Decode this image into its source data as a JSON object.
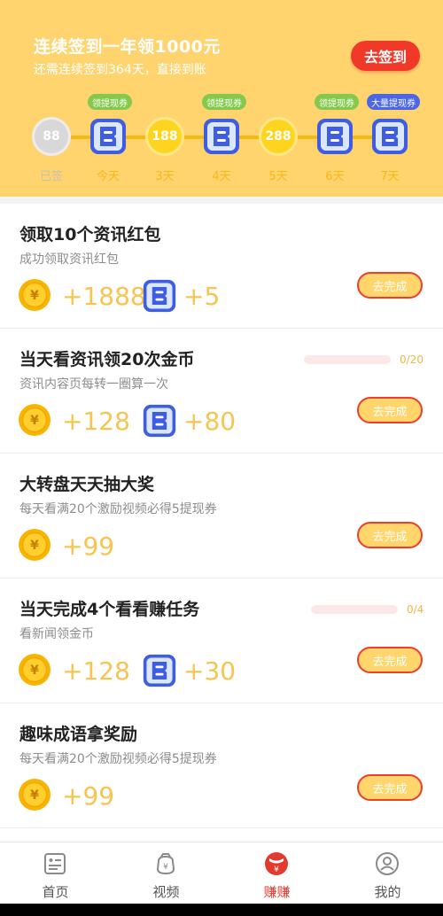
{
  "banner": {
    "title": "连续签到一年领1000元",
    "subtitle": "还需连续签到364天，直接到账",
    "checkin_label": "去签到"
  },
  "checkin_days": [
    {
      "type": "coin",
      "value": "88",
      "label": "已签",
      "state": "done"
    },
    {
      "type": "ticket",
      "label": "今天",
      "tag": "领提现券",
      "tag_color": "#84c94b"
    },
    {
      "type": "coin",
      "value": "188",
      "label": "3天"
    },
    {
      "type": "ticket",
      "label": "4天",
      "tag": "领提现券",
      "tag_color": "#84c94b"
    },
    {
      "type": "coin",
      "value": "288",
      "label": "5天"
    },
    {
      "type": "ticket",
      "label": "6天",
      "tag": "领提现券",
      "tag_color": "#84c94b"
    },
    {
      "type": "ticket",
      "label": "7天",
      "tag": "大量提现券",
      "tag_color": "#4b67e6"
    }
  ],
  "tasks": [
    {
      "title": "领取10个资讯红包",
      "desc": "成功领取资讯红包",
      "coin": "+1888",
      "ticket": "+5",
      "button": "去完成"
    },
    {
      "title": "当天看资讯领20次金币",
      "desc": "资讯内容页每转一圈算一次",
      "coin": "+128",
      "ticket": "+80",
      "button": "去完成",
      "progress": "0/20",
      "progress_value": 0
    },
    {
      "title": "大转盘天天抽大奖",
      "desc": "每天看满20个激励视频必得5提现券",
      "coin": "+99",
      "button": "去完成"
    },
    {
      "title": "当天完成4个看看赚任务",
      "desc": "看新闻领金币",
      "coin": "+128",
      "ticket": "+30",
      "button": "去完成",
      "progress": "0/4",
      "progress_value": 0
    },
    {
      "title": "趣味成语拿奖励",
      "desc": "每天看满20个激励视频必得5提现券",
      "coin": "+99",
      "button": "去完成"
    }
  ],
  "nav": [
    {
      "label": "首页",
      "icon": "home-icon"
    },
    {
      "label": "视频",
      "icon": "video-icon"
    },
    {
      "label": "赚赚",
      "icon": "earn-icon",
      "active": true
    },
    {
      "label": "我的",
      "icon": "profile-icon"
    }
  ],
  "colors": {
    "banner_bg": "#ffd46e",
    "accent_red": "#f1392a",
    "coin_gold": "#ffd41e",
    "ticket_blue": "#4b67e6"
  }
}
